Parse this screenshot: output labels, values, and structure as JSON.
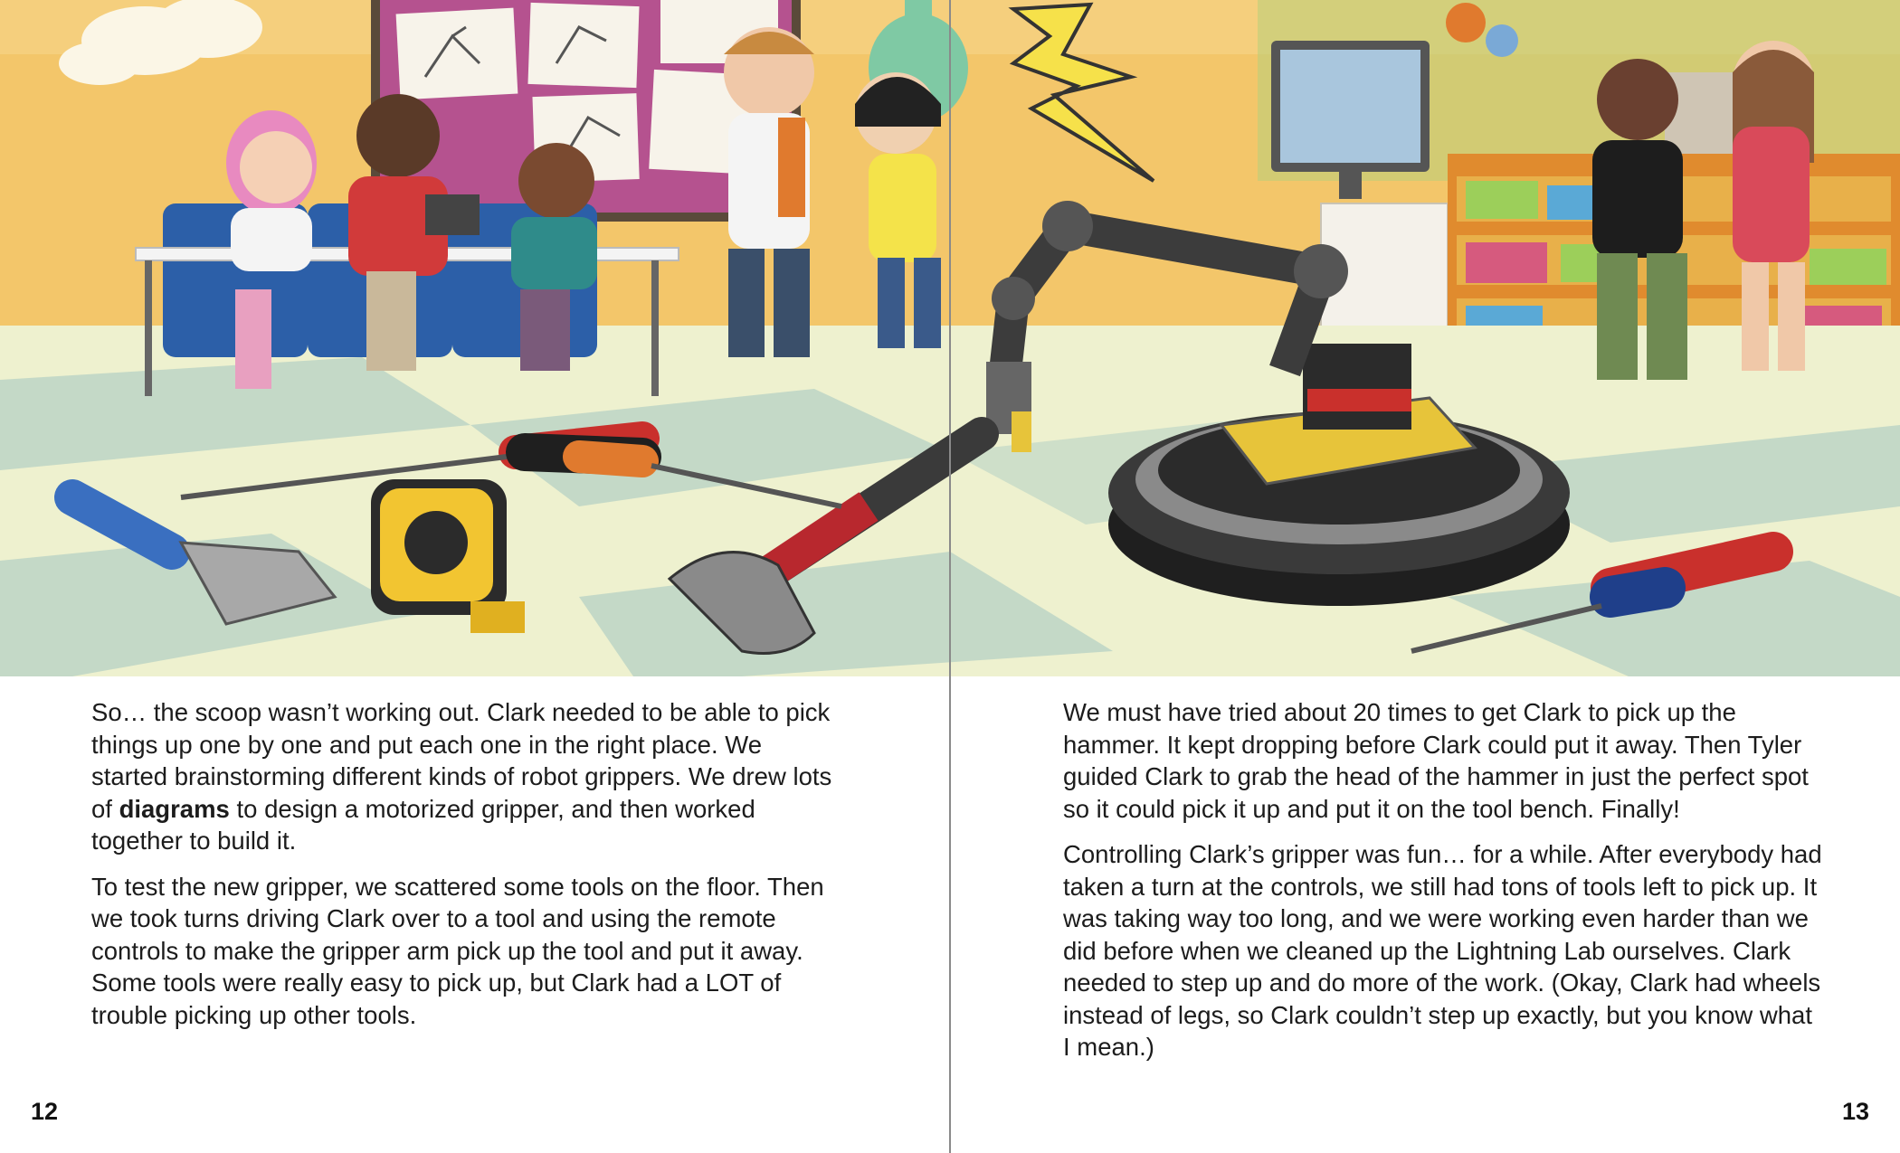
{
  "left_page": {
    "paragraph_1": {
      "before": "So… the scoop wasn’t working out. Clark needed to be able to pick things up one by one and put each one in the right place. We started brainstorming different kinds of robot grippers. We drew lots of ",
      "bold": "diagrams",
      "after": " to design a motorized gripper, and then worked together to build it."
    },
    "paragraph_2": "To test the new gripper, we scattered some tools on the floor. Then we took turns driving Clark over to a tool and using the remote controls to make the gripper arm pick up the tool and put it away. Some tools were really easy to pick up, but Clark had a LOT of trouble picking up other tools.",
    "page_number": "12"
  },
  "right_page": {
    "paragraph_1": "We must have tried about 20 times to get Clark to pick up the hammer. It kept dropping before Clark could put it away. Then Tyler guided Clark to grab the head of the hammer in just the perfect spot so it could pick it up and put it on the tool bench. Finally!",
    "paragraph_2": "Controlling Clark’s gripper was fun… for a while. After everybody had taken a turn at the controls, we still had tons of tools left to pick up. It was taking way too long, and we were working even harder than we did before when we cleaned up the Lightning Lab ourselves. Clark needed to step up and do more of the work. (Okay, Clark had wheels instead of legs, so Clark couldn’t step up exactly, but you know what I mean.)",
    "page_number": "13"
  },
  "colors": {
    "wall": "#f3c66a",
    "floor_light": "#eef1cf",
    "floor_dark": "#b9d3c4",
    "bulletin_board": "#b5528f",
    "robot_base": "#2b2b2b",
    "robot_frame": "#e7c43a",
    "text": "#1c1c1c"
  },
  "illustration_icons": [
    "kids-group-icon",
    "robot-clark-icon",
    "robot-arm-gripper-icon",
    "hammer-icon",
    "screwdriver-icon",
    "tape-measure-icon",
    "scraper-icon",
    "lightning-bolt-icon",
    "computer-monitor-icon",
    "bulletin-board-icon",
    "toy-shelf-icon",
    "light-bulb-lamp-icon"
  ]
}
